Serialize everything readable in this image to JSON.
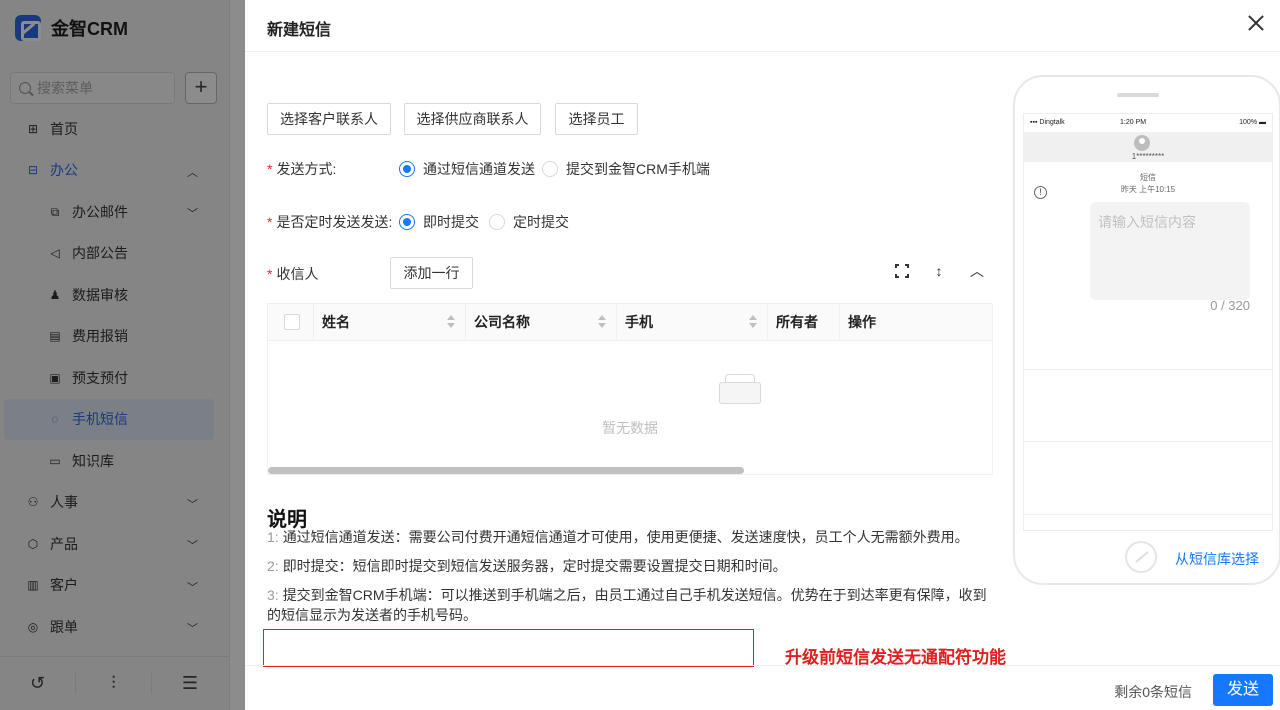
{
  "app": {
    "name": "金智CRM",
    "search_placeholder": "搜索菜单",
    "plus_label": "+",
    "nav": [
      {
        "label": "首页",
        "icon": "grid-icon"
      },
      {
        "label": "办公",
        "icon": "office-icon"
      },
      {
        "label": "办公邮件",
        "icon": "mail-icon"
      },
      {
        "label": "内部公告",
        "icon": "speaker-icon"
      },
      {
        "label": "数据审核",
        "icon": "user-icon"
      },
      {
        "label": "费用报销",
        "icon": "receipt-icon"
      },
      {
        "label": "预支预付",
        "icon": "wallet-icon"
      },
      {
        "label": "手机短信",
        "icon": "chat-icon"
      },
      {
        "label": "知识库",
        "icon": "book-icon"
      },
      {
        "label": "人事",
        "icon": "people-icon"
      },
      {
        "label": "产品",
        "icon": "box-icon"
      },
      {
        "label": "客户",
        "icon": "building-icon"
      },
      {
        "label": "跟单",
        "icon": "target-icon"
      }
    ]
  },
  "drawer": {
    "title": "新建短信",
    "select_buttons": [
      "选择客户联系人",
      "选择供应商联系人",
      "选择员工"
    ],
    "send_method": {
      "label": "发送方式:",
      "options": [
        "通过短信通道发送",
        "提交到金智CRM手机端"
      ],
      "selected": 0
    },
    "timed_send": {
      "label": "是否定时发送发送:",
      "options": [
        "即时提交",
        "定时提交"
      ],
      "selected": 0
    },
    "recipients": {
      "label": "收信人",
      "add_row_label": "添加一行"
    },
    "table": {
      "columns": [
        "姓名",
        "公司名称",
        "手机",
        "所有者",
        "操作"
      ],
      "empty_text": "暂无数据"
    },
    "description": {
      "title": "说明",
      "lines": [
        {
          "num": "1:",
          "text": "通过短信通道发送：需要公司付费开通短信通道才可使用，使用更便捷、发送速度快，员工个人无需额外费用。"
        },
        {
          "num": "2:",
          "text": "即时提交：短信即时提交到短信发送服务器，定时提交需要设置提交日期和时间。"
        },
        {
          "num": "3:",
          "text": "提交到金智CRM手机端：可以推送到手机端之后，由员工通过自己手机发送短信。优势在于到达率更有保障，收到的短信显示为发送者的手机号码。"
        }
      ]
    },
    "annotation": "升级前短信发送无通配符功能",
    "footer": {
      "remaining": "剩余0条短信",
      "send_label": "发送"
    },
    "phone": {
      "carrier": "Dingtalk",
      "time": "1:20 PM",
      "battery": "100%",
      "contact_name": "1*********",
      "msg_type": "短信",
      "msg_time": "昨天 上午10:15",
      "msg_placeholder": "请输入短信内容",
      "char_count": "0 / 320",
      "library_link": "从短信库选择"
    }
  }
}
